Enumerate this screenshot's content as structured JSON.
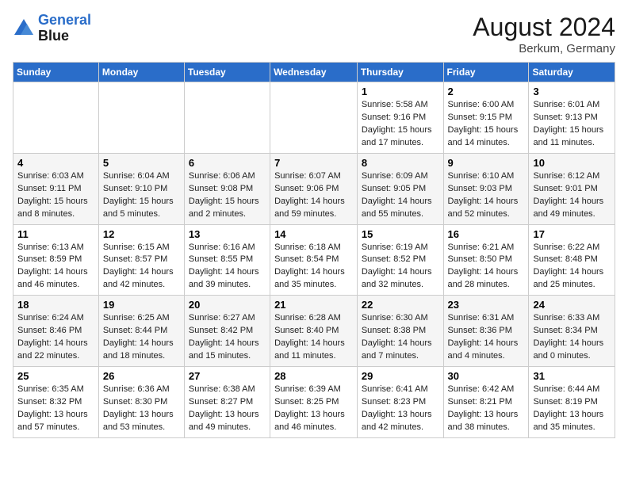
{
  "header": {
    "logo_line1": "General",
    "logo_line2": "Blue",
    "month_year": "August 2024",
    "location": "Berkum, Germany"
  },
  "weekdays": [
    "Sunday",
    "Monday",
    "Tuesday",
    "Wednesday",
    "Thursday",
    "Friday",
    "Saturday"
  ],
  "weeks": [
    [
      {
        "day": "",
        "info": ""
      },
      {
        "day": "",
        "info": ""
      },
      {
        "day": "",
        "info": ""
      },
      {
        "day": "",
        "info": ""
      },
      {
        "day": "1",
        "info": "Sunrise: 5:58 AM\nSunset: 9:16 PM\nDaylight: 15 hours\nand 17 minutes."
      },
      {
        "day": "2",
        "info": "Sunrise: 6:00 AM\nSunset: 9:15 PM\nDaylight: 15 hours\nand 14 minutes."
      },
      {
        "day": "3",
        "info": "Sunrise: 6:01 AM\nSunset: 9:13 PM\nDaylight: 15 hours\nand 11 minutes."
      }
    ],
    [
      {
        "day": "4",
        "info": "Sunrise: 6:03 AM\nSunset: 9:11 PM\nDaylight: 15 hours\nand 8 minutes."
      },
      {
        "day": "5",
        "info": "Sunrise: 6:04 AM\nSunset: 9:10 PM\nDaylight: 15 hours\nand 5 minutes."
      },
      {
        "day": "6",
        "info": "Sunrise: 6:06 AM\nSunset: 9:08 PM\nDaylight: 15 hours\nand 2 minutes."
      },
      {
        "day": "7",
        "info": "Sunrise: 6:07 AM\nSunset: 9:06 PM\nDaylight: 14 hours\nand 59 minutes."
      },
      {
        "day": "8",
        "info": "Sunrise: 6:09 AM\nSunset: 9:05 PM\nDaylight: 14 hours\nand 55 minutes."
      },
      {
        "day": "9",
        "info": "Sunrise: 6:10 AM\nSunset: 9:03 PM\nDaylight: 14 hours\nand 52 minutes."
      },
      {
        "day": "10",
        "info": "Sunrise: 6:12 AM\nSunset: 9:01 PM\nDaylight: 14 hours\nand 49 minutes."
      }
    ],
    [
      {
        "day": "11",
        "info": "Sunrise: 6:13 AM\nSunset: 8:59 PM\nDaylight: 14 hours\nand 46 minutes."
      },
      {
        "day": "12",
        "info": "Sunrise: 6:15 AM\nSunset: 8:57 PM\nDaylight: 14 hours\nand 42 minutes."
      },
      {
        "day": "13",
        "info": "Sunrise: 6:16 AM\nSunset: 8:55 PM\nDaylight: 14 hours\nand 39 minutes."
      },
      {
        "day": "14",
        "info": "Sunrise: 6:18 AM\nSunset: 8:54 PM\nDaylight: 14 hours\nand 35 minutes."
      },
      {
        "day": "15",
        "info": "Sunrise: 6:19 AM\nSunset: 8:52 PM\nDaylight: 14 hours\nand 32 minutes."
      },
      {
        "day": "16",
        "info": "Sunrise: 6:21 AM\nSunset: 8:50 PM\nDaylight: 14 hours\nand 28 minutes."
      },
      {
        "day": "17",
        "info": "Sunrise: 6:22 AM\nSunset: 8:48 PM\nDaylight: 14 hours\nand 25 minutes."
      }
    ],
    [
      {
        "day": "18",
        "info": "Sunrise: 6:24 AM\nSunset: 8:46 PM\nDaylight: 14 hours\nand 22 minutes."
      },
      {
        "day": "19",
        "info": "Sunrise: 6:25 AM\nSunset: 8:44 PM\nDaylight: 14 hours\nand 18 minutes."
      },
      {
        "day": "20",
        "info": "Sunrise: 6:27 AM\nSunset: 8:42 PM\nDaylight: 14 hours\nand 15 minutes."
      },
      {
        "day": "21",
        "info": "Sunrise: 6:28 AM\nSunset: 8:40 PM\nDaylight: 14 hours\nand 11 minutes."
      },
      {
        "day": "22",
        "info": "Sunrise: 6:30 AM\nSunset: 8:38 PM\nDaylight: 14 hours\nand 7 minutes."
      },
      {
        "day": "23",
        "info": "Sunrise: 6:31 AM\nSunset: 8:36 PM\nDaylight: 14 hours\nand 4 minutes."
      },
      {
        "day": "24",
        "info": "Sunrise: 6:33 AM\nSunset: 8:34 PM\nDaylight: 14 hours\nand 0 minutes."
      }
    ],
    [
      {
        "day": "25",
        "info": "Sunrise: 6:35 AM\nSunset: 8:32 PM\nDaylight: 13 hours\nand 57 minutes."
      },
      {
        "day": "26",
        "info": "Sunrise: 6:36 AM\nSunset: 8:30 PM\nDaylight: 13 hours\nand 53 minutes."
      },
      {
        "day": "27",
        "info": "Sunrise: 6:38 AM\nSunset: 8:27 PM\nDaylight: 13 hours\nand 49 minutes."
      },
      {
        "day": "28",
        "info": "Sunrise: 6:39 AM\nSunset: 8:25 PM\nDaylight: 13 hours\nand 46 minutes."
      },
      {
        "day": "29",
        "info": "Sunrise: 6:41 AM\nSunset: 8:23 PM\nDaylight: 13 hours\nand 42 minutes."
      },
      {
        "day": "30",
        "info": "Sunrise: 6:42 AM\nSunset: 8:21 PM\nDaylight: 13 hours\nand 38 minutes."
      },
      {
        "day": "31",
        "info": "Sunrise: 6:44 AM\nSunset: 8:19 PM\nDaylight: 13 hours\nand 35 minutes."
      }
    ]
  ]
}
